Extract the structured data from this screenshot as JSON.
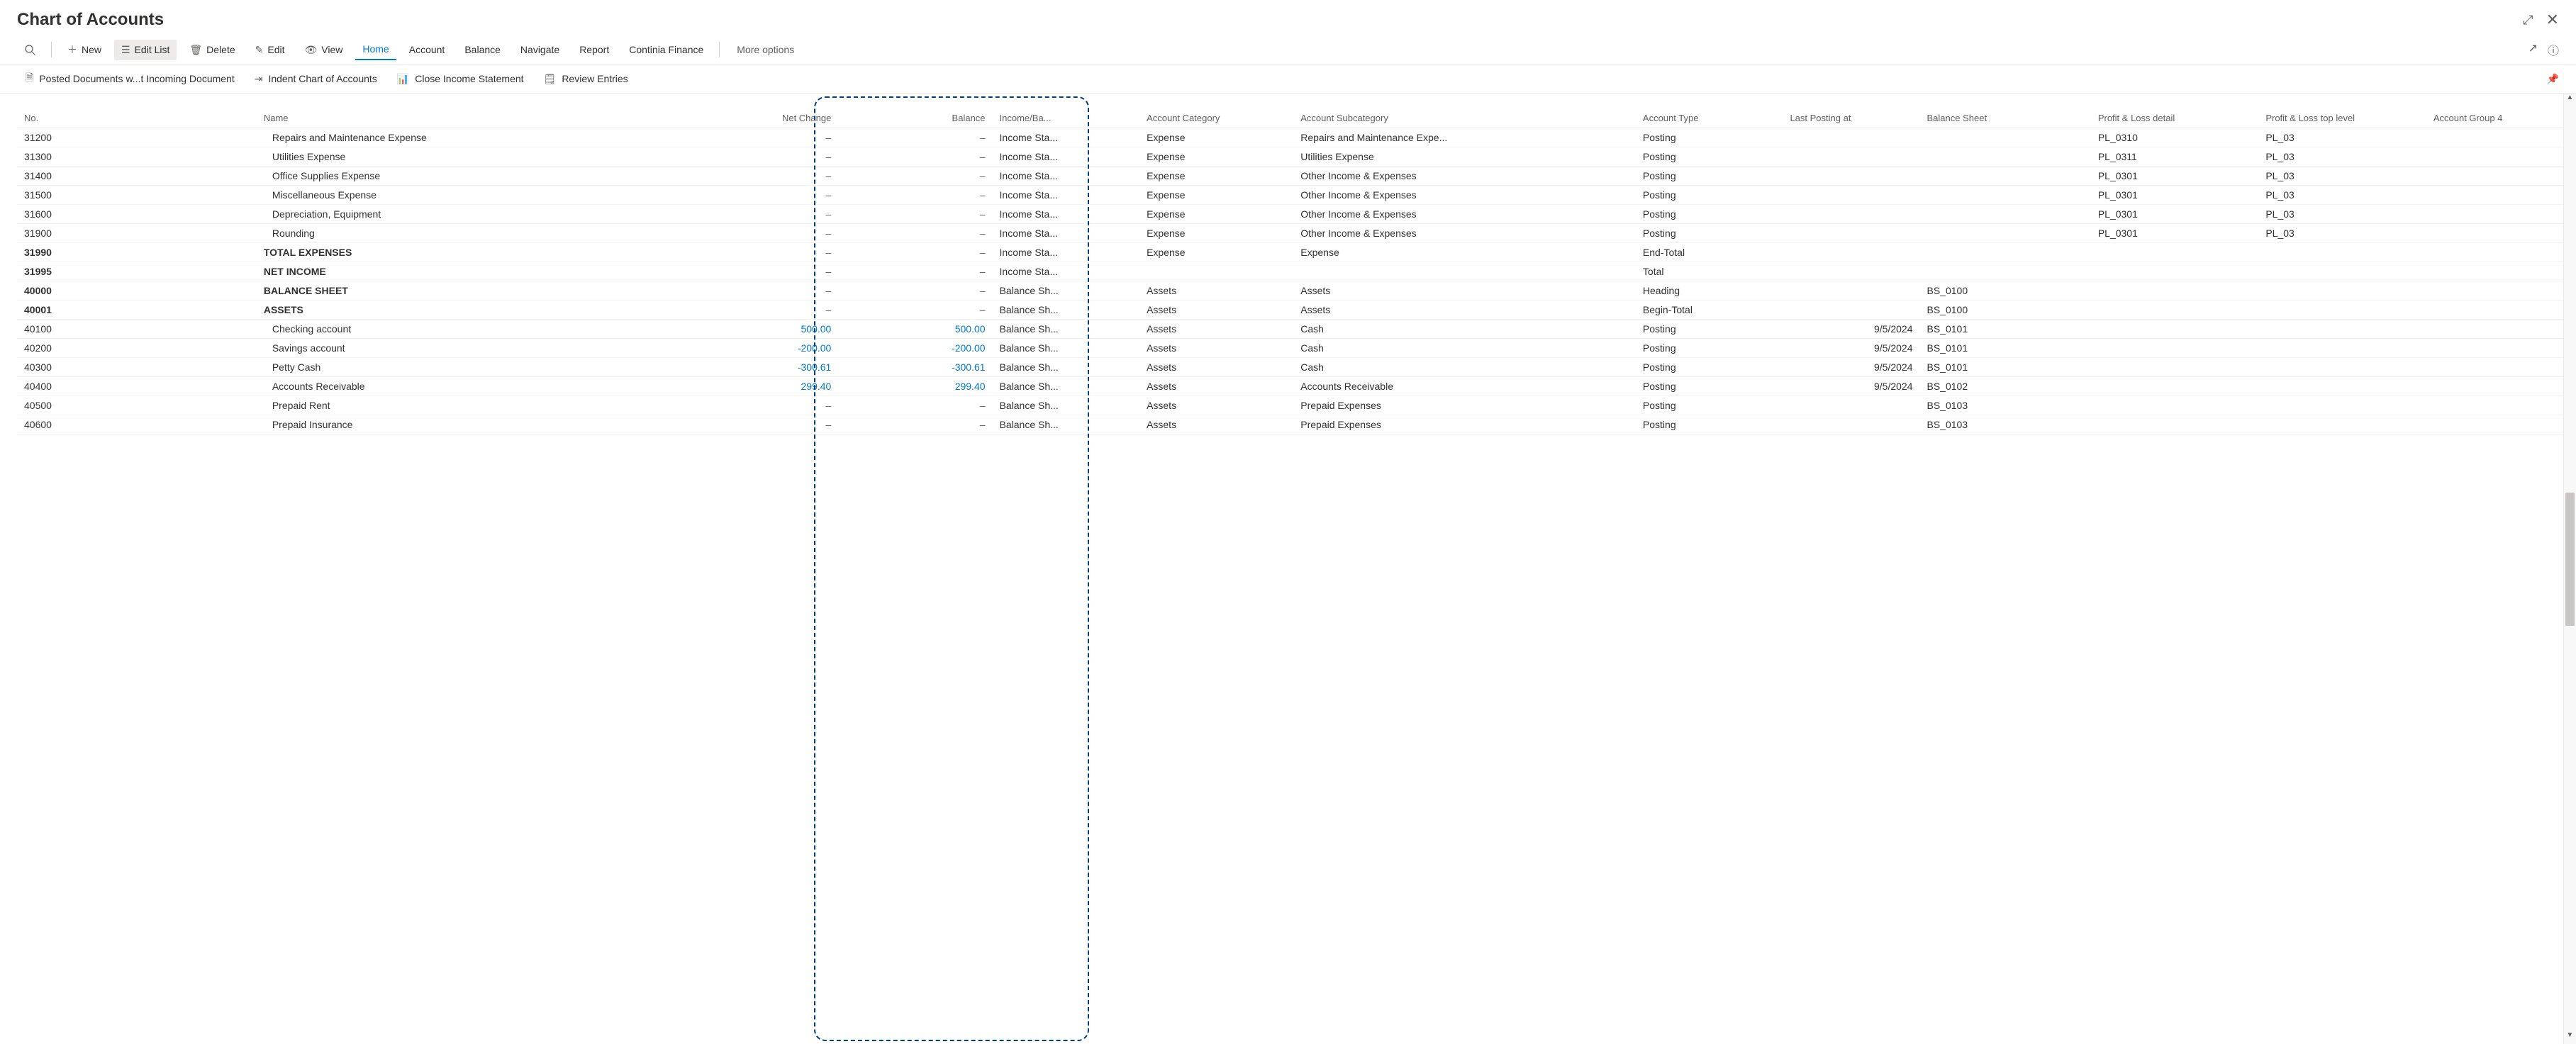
{
  "title": "Chart of Accounts",
  "commandbar": {
    "search_icon": "search",
    "new": "New",
    "edit_list": "Edit List",
    "delete": "Delete",
    "edit": "Edit",
    "view": "View",
    "home": "Home",
    "account": "Account",
    "balance": "Balance",
    "navigate": "Navigate",
    "report": "Report",
    "continia": "Continia Finance",
    "more": "More options"
  },
  "toolbar2": {
    "posted_docs": "Posted Documents w...t Incoming Document",
    "indent": "Indent Chart of Accounts",
    "close_income": "Close Income Statement",
    "review": "Review Entries"
  },
  "columns": {
    "no": "No.",
    "name": "Name",
    "net_change": "Net Change",
    "balance": "Balance",
    "income_bal": "Income/Ba...",
    "acct_category": "Account Category",
    "acct_subcategory": "Account Subcategory",
    "acct_type": "Account Type",
    "last_posting": "Last Posting at",
    "balance_sheet": "Balance Sheet",
    "pl_detail": "Profit & Loss detail",
    "pl_top": "Profit & Loss top level",
    "acct_group4": "Account Group 4"
  },
  "rows": [
    {
      "no": "31200",
      "name": "Repairs and Maintenance Expense",
      "net_change": "–",
      "balance": "–",
      "income_bal": "Income Sta...",
      "category": "Expense",
      "subcategory": "Repairs and Maintenance Expe...",
      "type": "Posting",
      "last_post": "",
      "bs": "",
      "pld": "PL_0310",
      "plt": "PL_03",
      "ag4": "",
      "bold": false,
      "indent": true
    },
    {
      "no": "31300",
      "name": "Utilities Expense",
      "net_change": "–",
      "balance": "–",
      "income_bal": "Income Sta...",
      "category": "Expense",
      "subcategory": "Utilities Expense",
      "type": "Posting",
      "last_post": "",
      "bs": "",
      "pld": "PL_0311",
      "plt": "PL_03",
      "ag4": "",
      "bold": false,
      "indent": true
    },
    {
      "no": "31400",
      "name": "Office Supplies Expense",
      "net_change": "–",
      "balance": "–",
      "income_bal": "Income Sta...",
      "category": "Expense",
      "subcategory": "Other Income & Expenses",
      "type": "Posting",
      "last_post": "",
      "bs": "",
      "pld": "PL_0301",
      "plt": "PL_03",
      "ag4": "",
      "bold": false,
      "indent": true
    },
    {
      "no": "31500",
      "name": "Miscellaneous Expense",
      "net_change": "–",
      "balance": "–",
      "income_bal": "Income Sta...",
      "category": "Expense",
      "subcategory": "Other Income & Expenses",
      "type": "Posting",
      "last_post": "",
      "bs": "",
      "pld": "PL_0301",
      "plt": "PL_03",
      "ag4": "",
      "bold": false,
      "indent": true
    },
    {
      "no": "31600",
      "name": "Depreciation, Equipment",
      "net_change": "–",
      "balance": "–",
      "income_bal": "Income Sta...",
      "category": "Expense",
      "subcategory": "Other Income & Expenses",
      "type": "Posting",
      "last_post": "",
      "bs": "",
      "pld": "PL_0301",
      "plt": "PL_03",
      "ag4": "",
      "bold": false,
      "indent": true
    },
    {
      "no": "31900",
      "name": "Rounding",
      "net_change": "–",
      "balance": "–",
      "income_bal": "Income Sta...",
      "category": "Expense",
      "subcategory": "Other Income & Expenses",
      "type": "Posting",
      "last_post": "",
      "bs": "",
      "pld": "PL_0301",
      "plt": "PL_03",
      "ag4": "",
      "bold": false,
      "indent": true
    },
    {
      "no": "31990",
      "name": "TOTAL EXPENSES",
      "net_change": "–",
      "balance": "–",
      "income_bal": "Income Sta...",
      "category": "Expense",
      "subcategory": "Expense",
      "type": "End-Total",
      "last_post": "",
      "bs": "",
      "pld": "",
      "plt": "",
      "ag4": "",
      "bold": true,
      "indent": false
    },
    {
      "no": "31995",
      "name": "NET INCOME",
      "net_change": "–",
      "balance": "–",
      "income_bal": "Income Sta...",
      "category": "",
      "subcategory": "",
      "type": "Total",
      "last_post": "",
      "bs": "",
      "pld": "",
      "plt": "",
      "ag4": "",
      "bold": true,
      "indent": false
    },
    {
      "no": "40000",
      "name": "BALANCE SHEET",
      "net_change": "–",
      "balance": "–",
      "income_bal": "Balance Sh...",
      "category": "Assets",
      "subcategory": "Assets",
      "type": "Heading",
      "last_post": "",
      "bs": "BS_0100",
      "pld": "",
      "plt": "",
      "ag4": "",
      "bold": true,
      "indent": false
    },
    {
      "no": "40001",
      "name": "ASSETS",
      "net_change": "–",
      "balance": "–",
      "income_bal": "Balance Sh...",
      "category": "Assets",
      "subcategory": "Assets",
      "type": "Begin-Total",
      "last_post": "",
      "bs": "BS_0100",
      "pld": "",
      "plt": "",
      "ag4": "",
      "bold": true,
      "indent": false
    },
    {
      "no": "40100",
      "name": "Checking account",
      "net_change": "500.00",
      "balance": "500.00",
      "income_bal": "Balance Sh...",
      "category": "Assets",
      "subcategory": "Cash",
      "type": "Posting",
      "last_post": "9/5/2024",
      "bs": "BS_0101",
      "pld": "",
      "plt": "",
      "ag4": "",
      "bold": false,
      "indent": true,
      "numcls": "link"
    },
    {
      "no": "40200",
      "name": "Savings account",
      "net_change": "-200.00",
      "balance": "-200.00",
      "income_bal": "Balance Sh...",
      "category": "Assets",
      "subcategory": "Cash",
      "type": "Posting",
      "last_post": "9/5/2024",
      "bs": "BS_0101",
      "pld": "",
      "plt": "",
      "ag4": "",
      "bold": false,
      "indent": true,
      "numcls": "link"
    },
    {
      "no": "40300",
      "name": "Petty Cash",
      "net_change": "-300.61",
      "balance": "-300.61",
      "income_bal": "Balance Sh...",
      "category": "Assets",
      "subcategory": "Cash",
      "type": "Posting",
      "last_post": "9/5/2024",
      "bs": "BS_0101",
      "pld": "",
      "plt": "",
      "ag4": "",
      "bold": false,
      "indent": true,
      "numcls": "link"
    },
    {
      "no": "40400",
      "name": "Accounts Receivable",
      "net_change": "299.40",
      "balance": "299.40",
      "income_bal": "Balance Sh...",
      "category": "Assets",
      "subcategory": "Accounts Receivable",
      "type": "Posting",
      "last_post": "9/5/2024",
      "bs": "BS_0102",
      "pld": "",
      "plt": "",
      "ag4": "",
      "bold": false,
      "indent": true,
      "numcls": "link"
    },
    {
      "no": "40500",
      "name": "Prepaid Rent",
      "net_change": "–",
      "balance": "–",
      "income_bal": "Balance Sh...",
      "category": "Assets",
      "subcategory": "Prepaid Expenses",
      "type": "Posting",
      "last_post": "",
      "bs": "BS_0103",
      "pld": "",
      "plt": "",
      "ag4": "",
      "bold": false,
      "indent": true
    },
    {
      "no": "40600",
      "name": "Prepaid Insurance",
      "net_change": "–",
      "balance": "–",
      "income_bal": "Balance Sh...",
      "category": "Assets",
      "subcategory": "Prepaid Expenses",
      "type": "Posting",
      "last_post": "",
      "bs": "BS_0103",
      "pld": "",
      "plt": "",
      "ag4": "",
      "bold": false,
      "indent": true
    }
  ]
}
